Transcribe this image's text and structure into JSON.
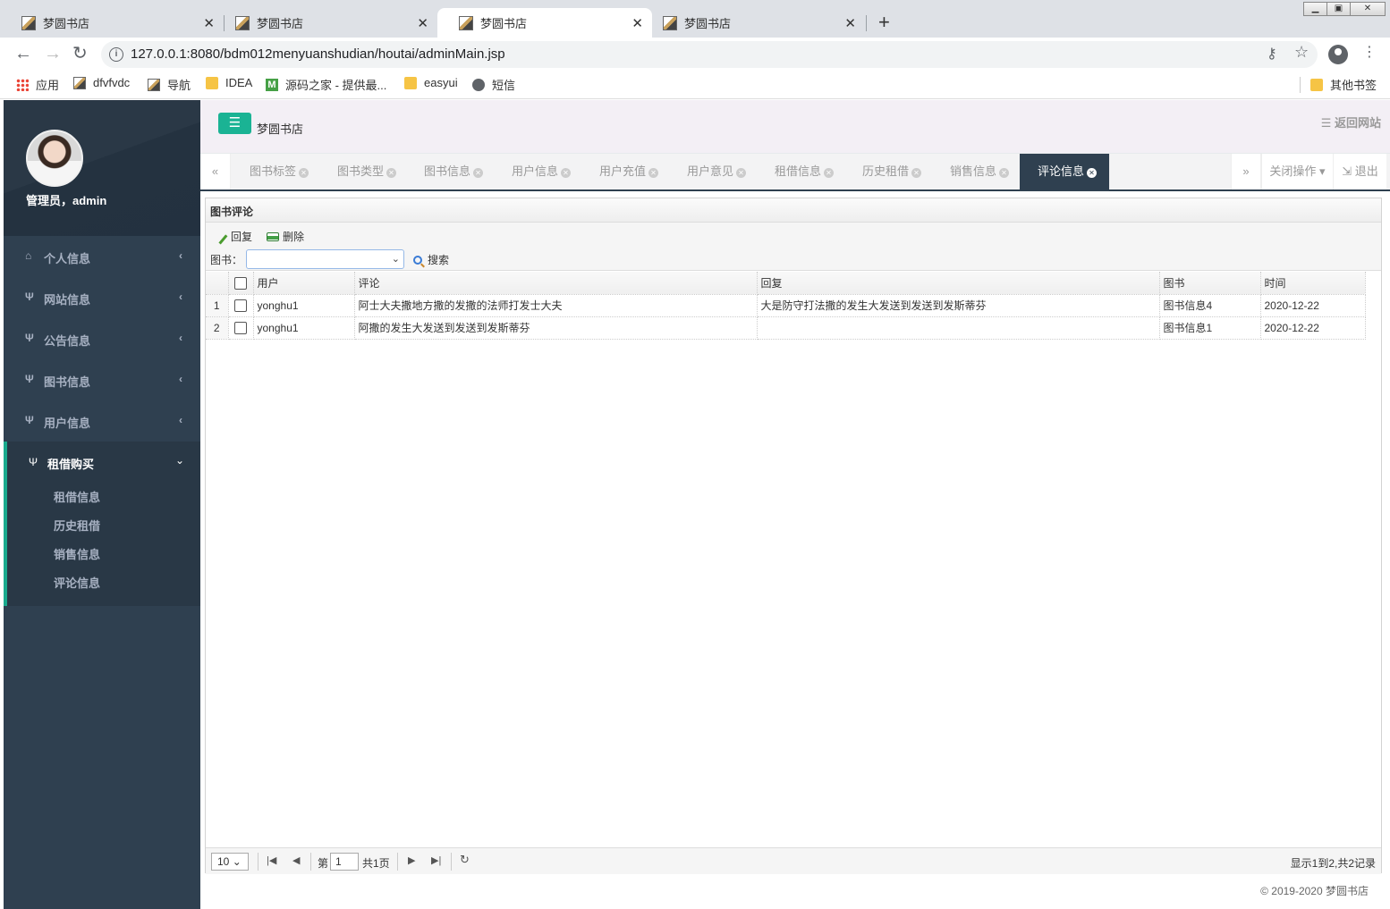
{
  "browser": {
    "tabs": [
      {
        "title": "梦圆书店"
      },
      {
        "title": "梦圆书店"
      },
      {
        "title": "梦圆书店"
      },
      {
        "title": "梦圆书店"
      }
    ],
    "url": "127.0.0.1:8080/bdm012menyuanshudian/houtai/adminMain.jsp",
    "bookmarks": [
      {
        "label": "应用",
        "icon": "apps-icon"
      },
      {
        "label": "dfvfvdc",
        "icon": "image-icon"
      },
      {
        "label": "导航",
        "icon": "image-icon"
      },
      {
        "label": "IDEA",
        "icon": "folder-icon"
      },
      {
        "label": "源码之家 - 提供最...",
        "icon": "m-icon"
      },
      {
        "label": "easyui",
        "icon": "folder-icon"
      },
      {
        "label": "短信",
        "icon": "globe-icon"
      }
    ],
    "other_bookmarks": "其他书签"
  },
  "sidebar": {
    "user": "管理员，admin",
    "items": [
      {
        "label": "个人信息",
        "icon": "home-icon"
      },
      {
        "label": "网站信息",
        "icon": "cutlery-icon"
      },
      {
        "label": "公告信息",
        "icon": "cutlery-icon"
      },
      {
        "label": "图书信息",
        "icon": "cutlery-icon"
      },
      {
        "label": "用户信息",
        "icon": "cutlery-icon"
      }
    ],
    "active": {
      "label": "租借购买",
      "icon": "cutlery-icon",
      "children": [
        "租借信息",
        "历史租借",
        "销售信息",
        "评论信息"
      ]
    }
  },
  "header": {
    "title": "梦圆书店",
    "back_link": "返回网站"
  },
  "page_tabs": [
    {
      "label": "图书标签"
    },
    {
      "label": "图书类型"
    },
    {
      "label": "图书信息"
    },
    {
      "label": "用户信息"
    },
    {
      "label": "用户充值"
    },
    {
      "label": "用户意见"
    },
    {
      "label": "租借信息"
    },
    {
      "label": "历史租借"
    },
    {
      "label": "销售信息"
    },
    {
      "label": "评论信息",
      "active": true
    }
  ],
  "tab_actions": {
    "close_ops": "关闭操作",
    "logout": "退出"
  },
  "panel": {
    "title": "图书评论",
    "reply_button": "回复",
    "delete_button": "删除",
    "filter_label": "图书：",
    "filter_value": "",
    "search_button": "搜索"
  },
  "grid": {
    "columns": [
      "用户",
      "评论",
      "回复",
      "图书",
      "时间"
    ],
    "rows": [
      {
        "num": "1",
        "user": "yonghu1",
        "comment": "阿士大夫撒地方撒的发撒的法师打发士大夫",
        "reply": "大是防守打法撒的发生大发送到发送到发斯蒂芬",
        "book": "图书信息4",
        "time": "2020-12-22"
      },
      {
        "num": "2",
        "user": "yonghu1",
        "comment": "阿撒的发生大发送到发送到发斯蒂芬",
        "reply": "",
        "book": "图书信息1",
        "time": "2020-12-22"
      }
    ]
  },
  "pager": {
    "page_size": "10",
    "page_prefix": "第",
    "page_value": "1",
    "page_total": "共1页",
    "info": "显示1到2,共2记录"
  },
  "footer": "© 2019-2020 梦圆书店"
}
